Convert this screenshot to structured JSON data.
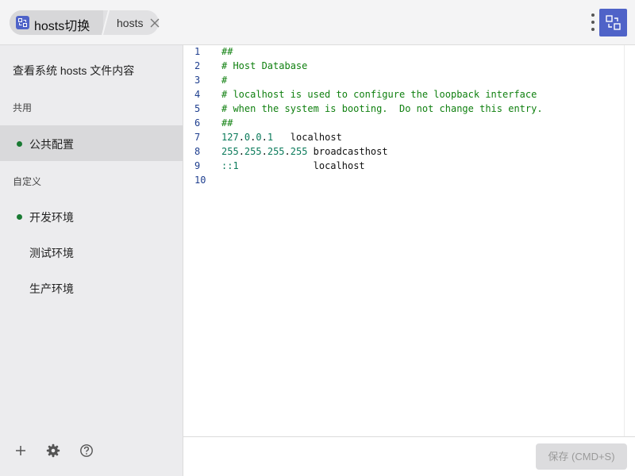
{
  "titlebar": {
    "tab_main_title": "hosts切换",
    "tab_second_label": "hosts"
  },
  "sidebar": {
    "system_item": "查看系统 hosts 文件内容",
    "shared_section": "共用",
    "shared_items": [
      {
        "label": "公共配置",
        "enabled": true,
        "active": true
      }
    ],
    "custom_section": "自定义",
    "custom_items": [
      {
        "label": "开发环境",
        "enabled": true
      },
      {
        "label": "测试环境",
        "enabled": false
      },
      {
        "label": "生产环境",
        "enabled": false
      }
    ]
  },
  "editor": {
    "lines": [
      {
        "num": "1",
        "text": "##"
      },
      {
        "num": "2",
        "text": "# Host Database"
      },
      {
        "num": "3",
        "text": "#"
      },
      {
        "num": "4",
        "text": "# localhost is used to configure the loopback interface"
      },
      {
        "num": "5",
        "text": "# when the system is booting.  Do not change this entry."
      },
      {
        "num": "6",
        "text": "##"
      },
      {
        "num": "7",
        "text": "127.0.0.1   localhost"
      },
      {
        "num": "8",
        "text": "255.255.255.255 broadcasthost"
      },
      {
        "num": "9",
        "text": "::1             localhost"
      },
      {
        "num": "10",
        "text": ""
      }
    ]
  },
  "footer": {
    "save_label": "保存 (CMD+S)"
  },
  "colors": {
    "accent": "#4f63c8",
    "enabled_dot": "#1a7a33",
    "comment": "#108010"
  },
  "icons": [
    "app-icon",
    "close-icon",
    "more-vertical-icon",
    "swap-icon",
    "add-icon",
    "gear-icon",
    "help-icon"
  ]
}
